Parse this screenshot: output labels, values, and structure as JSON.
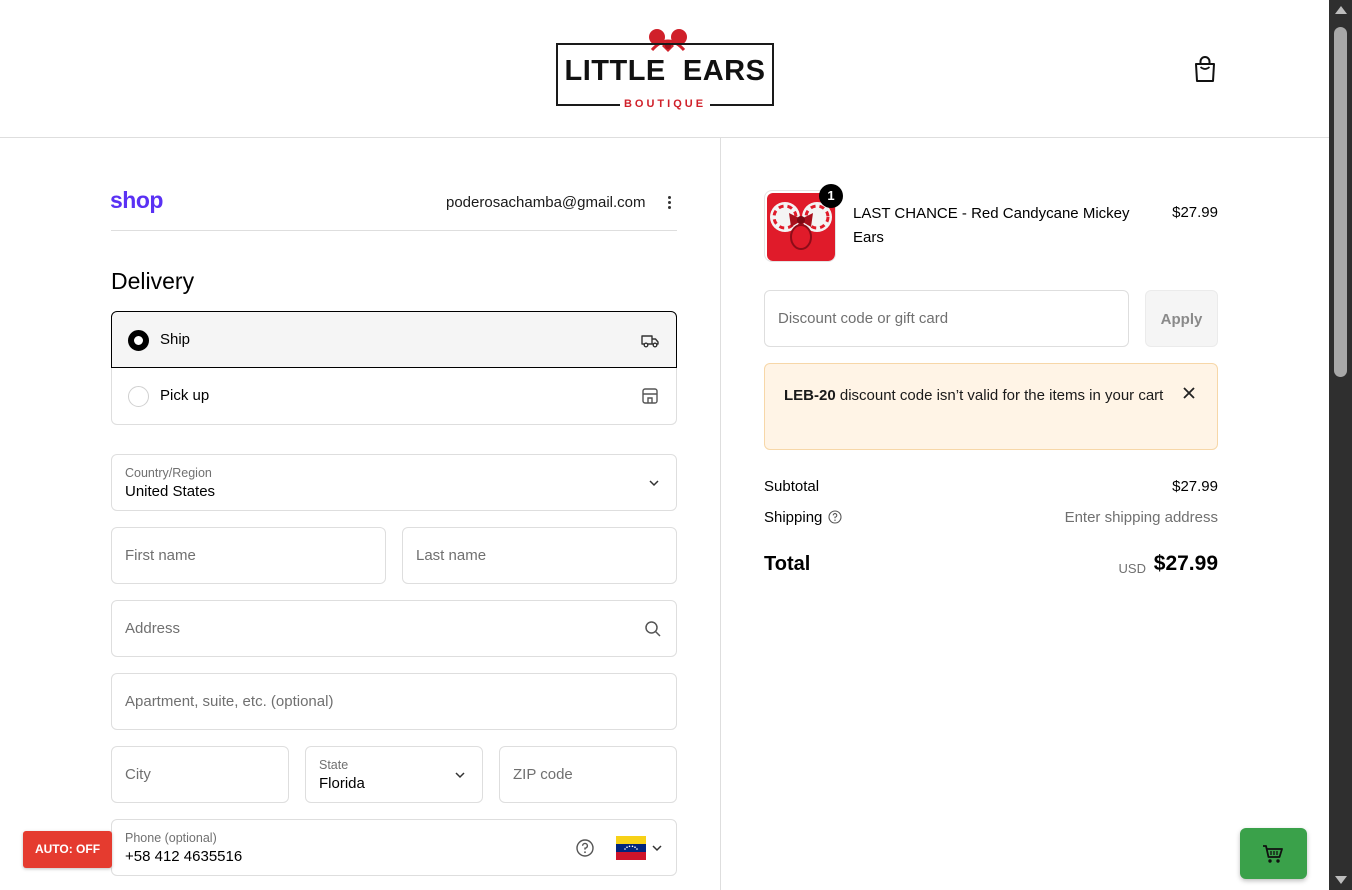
{
  "header": {
    "logo": {
      "main": "LITTLE  EARS",
      "sub": "BOUTIQUE"
    },
    "cart_icon": "shopping-bag-icon"
  },
  "account": {
    "shop_brand": "shop",
    "email": "poderosachamba@gmail.com"
  },
  "delivery": {
    "title": "Delivery",
    "options": [
      {
        "label": "Ship",
        "selected": true,
        "icon": "truck-icon"
      },
      {
        "label": "Pick up",
        "selected": false,
        "icon": "store-icon"
      }
    ]
  },
  "address_form": {
    "country": {
      "label": "Country/Region",
      "value": "United States"
    },
    "first_name": {
      "placeholder": "First name"
    },
    "last_name": {
      "placeholder": "Last name"
    },
    "address": {
      "placeholder": "Address"
    },
    "apartment": {
      "placeholder": "Apartment, suite, etc. (optional)"
    },
    "city": {
      "placeholder": "City"
    },
    "state": {
      "label": "State",
      "value": "Florida"
    },
    "zip": {
      "placeholder": "ZIP code"
    },
    "phone": {
      "label": "Phone (optional)",
      "value": "+58 412 4635516",
      "flag": "venezuela-flag-icon"
    }
  },
  "order": {
    "item": {
      "name": "LAST CHANCE - Red Candycane Mickey Ears",
      "price": "$27.99",
      "quantity": "1"
    },
    "discount": {
      "placeholder": "Discount code or gift card",
      "apply_label": "Apply"
    },
    "alert": {
      "code": "LEB-20",
      "message": " discount code isn’t valid for the items in your cart"
    },
    "subtotal": {
      "label": "Subtotal",
      "value": "$27.99"
    },
    "shipping": {
      "label": "Shipping",
      "value": "Enter shipping address"
    },
    "total": {
      "label": "Total",
      "currency": "USD",
      "value": "$27.99"
    }
  },
  "floating": {
    "auto_label": "AUTO: OFF",
    "cart_icon": "cart-icon"
  },
  "colors": {
    "shop_brand": "#5a31f4",
    "logo_red": "#d0202a",
    "alert_bg": "#fff4e6",
    "auto_btn": "#e53b2f",
    "float_cart": "#3aa14a"
  }
}
